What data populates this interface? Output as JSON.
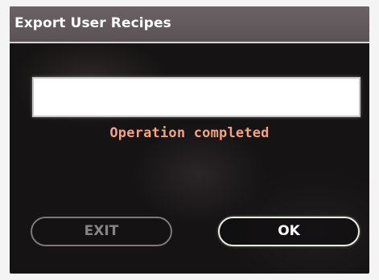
{
  "dialog": {
    "title": "Export User Recipes",
    "progress_fraction": 1.0,
    "status": "Operation completed"
  },
  "buttons": {
    "exit_label": "EXIT",
    "ok_label": "OK"
  },
  "colors": {
    "title_bar": "#6b6265",
    "background": "#151314",
    "status_text": "#f3a27e",
    "ok_border": "#e8eee0",
    "exit_border": "#7f7779"
  }
}
